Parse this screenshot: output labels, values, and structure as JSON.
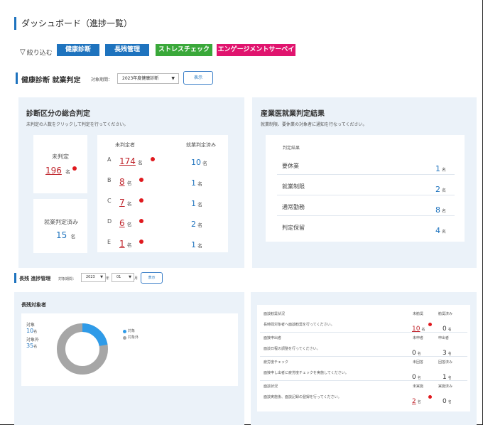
{
  "page": {
    "title": "ダッシュボード（進捗一覧）"
  },
  "filter": {
    "label": "絞り込む",
    "tags": [
      {
        "label": "健康診断",
        "color": "#1e73be"
      },
      {
        "label": "長残管理",
        "color": "#1e73be"
      },
      {
        "label": "ストレスチェック",
        "color": "#3aa83a"
      },
      {
        "label": "エンゲージメントサーベイ",
        "color": "#e0146e"
      }
    ]
  },
  "health": {
    "title": "健康診断 就業判定",
    "period_label": "対象期間：",
    "period_value": "2023年度健康診断",
    "show_button": "表示",
    "diagnosis": {
      "title": "診断区分の総合判定",
      "subtitle": "未判定の人数をクリックして判定を行ってください。",
      "undetermined_label": "未判定",
      "undetermined_count": "196",
      "determined_label": "就業判定済み",
      "determined_count": "15",
      "unit": "名",
      "col_undetermined": "未判定者",
      "col_determined": "就業判定済み",
      "rows": [
        {
          "cls": "A",
          "undetermined": "174",
          "determined": "10"
        },
        {
          "cls": "B",
          "undetermined": "8",
          "determined": "1"
        },
        {
          "cls": "C",
          "undetermined": "7",
          "determined": "1"
        },
        {
          "cls": "D",
          "undetermined": "6",
          "determined": "2"
        },
        {
          "cls": "E",
          "undetermined": "1",
          "determined": "1"
        }
      ]
    },
    "industrial": {
      "title": "産業医就業判定結果",
      "subtitle": "就業制限、要休業の対象者に通知を行なってください。",
      "header": "判定結果",
      "unit": "名",
      "rows": [
        {
          "label": "要休業",
          "value": "1"
        },
        {
          "label": "就業制限",
          "value": "2"
        },
        {
          "label": "通常勤務",
          "value": "8"
        },
        {
          "label": "判定保留",
          "value": "4"
        }
      ]
    }
  },
  "overtime": {
    "title": "長残 進捗管理",
    "period_label": "対象期間：",
    "year": "2023",
    "year_unit": "年",
    "month": "01",
    "month_unit": "月",
    "show_button": "表示",
    "targets": {
      "title": "長残対象者",
      "target_label": "対象",
      "target_count": "10",
      "non_target_label": "対象外",
      "non_target_count": "35",
      "unit": "名",
      "legend_target": "対象",
      "legend_non_target": "対象外",
      "colors": {
        "target": "#2f9be8",
        "non_target": "#a6a6a6"
      }
    },
    "progress": {
      "unit": "名",
      "items": [
        {
          "title": "面談勧奨状況",
          "desc": "長時間対象者へ面談勧奨を行ってください。",
          "col1": "未勧奨",
          "col2": "勧奨済み",
          "v1": "10",
          "v2": "0",
          "v1_alert": true
        },
        {
          "title": "面接申出者",
          "desc": "面談日程の調整を行ってください。",
          "col1": "未申者",
          "col2": "申出者",
          "v1": "0",
          "v2": "3",
          "v1_alert": false
        },
        {
          "title": "疲労度チェック",
          "desc": "面接申し出者に疲労度チェックを実施してください。",
          "col1": "未回答",
          "col2": "回答済み",
          "v1": "0",
          "v2": "1",
          "v1_alert": false
        },
        {
          "title": "面談状況",
          "desc": "面談実施後、面談記録の登録を行ってください。",
          "col1": "未実施",
          "col2": "実施済み",
          "v1": "2",
          "v2": "0",
          "v1_alert": true
        }
      ]
    }
  }
}
